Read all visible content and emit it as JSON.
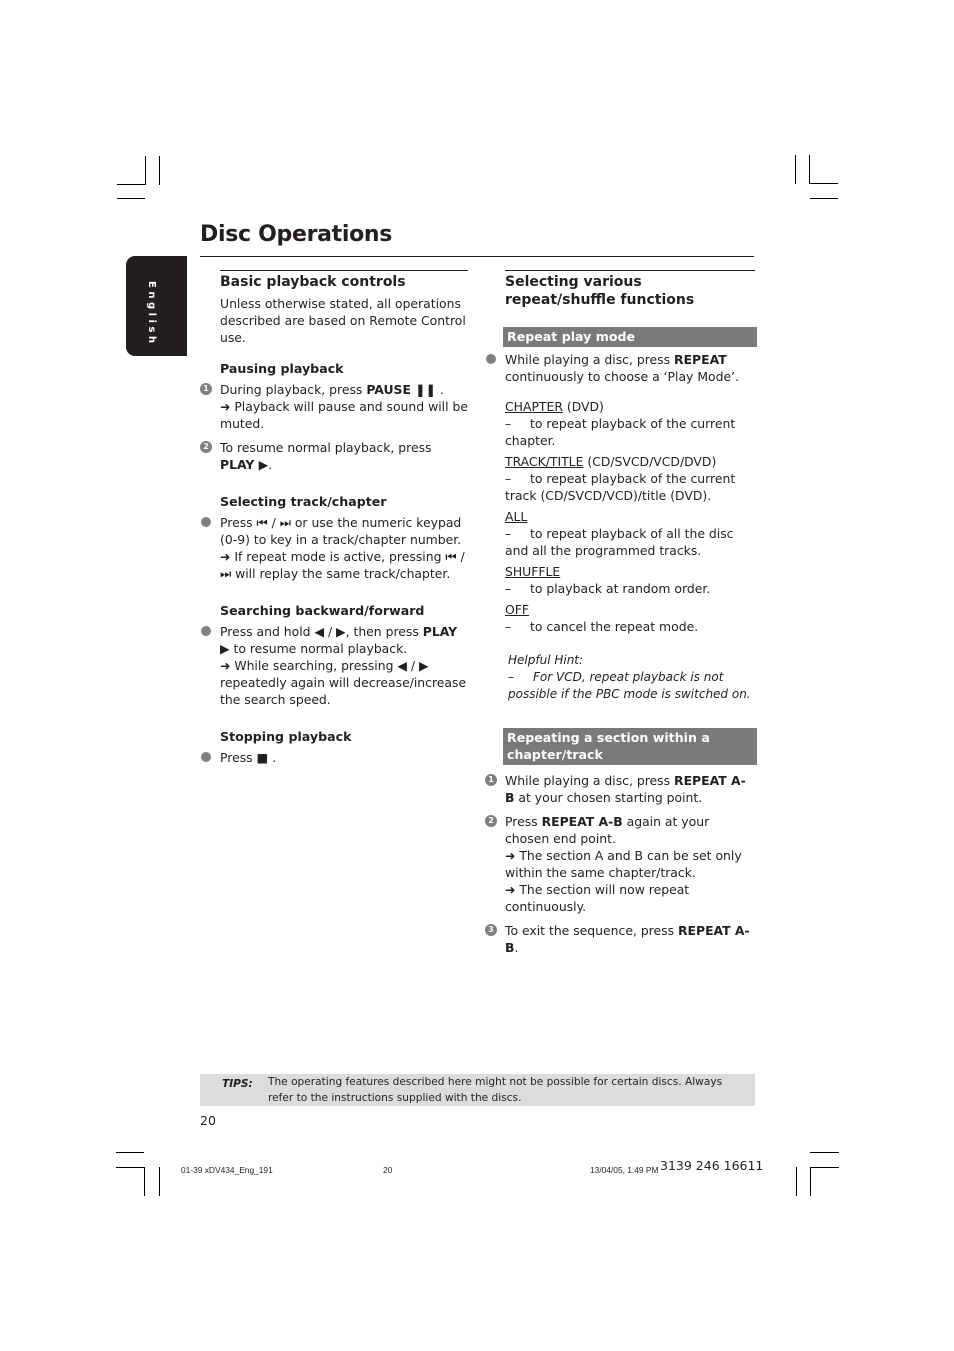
{
  "page": {
    "title": "Disc Operations",
    "language_tab": "English",
    "page_number": "20"
  },
  "left": {
    "section_title": "Basic playback controls",
    "intro": "Unless otherwise stated, all operations described are based on Remote Control use.",
    "pausing": {
      "title": "Pausing playback",
      "steps": [
        {
          "num": "1",
          "pre": "During playback, press ",
          "key": "PAUSE ❚❚",
          "post": " .",
          "note": "➜ Playback will pause and sound will be muted."
        },
        {
          "num": "2",
          "pre": "To resume normal playback, press ",
          "key": "PLAY ▶",
          "post": "."
        }
      ]
    },
    "selecting": {
      "title": "Selecting track/chapter",
      "text1": "Press ⏮ / ⏭ or use the numeric keypad (0-9) to key in a track/chapter number.",
      "note": "➜ If repeat mode is active, pressing ⏮ / ⏭ will replay the same track/chapter."
    },
    "searching": {
      "title": "Searching backward/forward",
      "pre": "Press and hold ◀ / ▶, then press ",
      "key": "PLAY",
      "post": " ▶ to resume normal playback.",
      "note": "➜ While searching, pressing ◀ / ▶ repeatedly again will decrease/increase the search speed."
    },
    "stopping": {
      "title": "Stopping playback",
      "text": "Press ■ ."
    }
  },
  "right": {
    "section_title": "Selecting various repeat/shuffle functions",
    "repeat_band": "Repeat play mode",
    "repeat_intro_pre": "While playing a disc, press ",
    "repeat_intro_key": "REPEAT",
    "repeat_intro_post": " continuously to choose a ‘Play Mode’.",
    "modes": [
      {
        "name": "CHAPTER",
        "suffix": " (DVD)",
        "desc": "to repeat playback of the current chapter."
      },
      {
        "name": "TRACK/TITLE",
        "suffix": " (CD/SVCD/VCD/DVD)",
        "desc": "to repeat playback of the current track (CD/SVCD/VCD)/title (DVD)."
      },
      {
        "name": "ALL",
        "suffix": "",
        "desc": "to repeat playback of all the disc and all the programmed tracks."
      },
      {
        "name": "SHUFFLE",
        "suffix": "",
        "desc": "to playback at random order."
      },
      {
        "name": "OFF",
        "suffix": "",
        "desc": "to cancel the repeat mode."
      }
    ],
    "hint_title": "Helpful Hint:",
    "hint_text": "For VCD, repeat playback is not possible if the PBC mode is switched on.",
    "ab_band": "Repeating a section within a chapter/track",
    "ab_steps": [
      {
        "num": "1",
        "pre": "While playing a disc, press ",
        "key": "REPEAT A-B",
        "post": " at your chosen starting point."
      },
      {
        "num": "2",
        "pre": "Press ",
        "key": "REPEAT A-B",
        "post": " again at your chosen end point.",
        "note1": "➜ The section A and B can be set only within the same chapter/track.",
        "note2": "➜ The section will now repeat continuously."
      },
      {
        "num": "3",
        "pre": "To exit the sequence, press ",
        "key": "REPEAT A-B",
        "post": "."
      }
    ]
  },
  "tips": {
    "label": "TIPS:",
    "text": "The operating features described here might not be possible for certain discs.  Always refer to the instructions supplied with the discs."
  },
  "footer": {
    "file": "01-39 xDV434_Eng_191",
    "page": "20",
    "date": "13/04/05, 1:49 PM",
    "code": "3139 246 16611"
  }
}
